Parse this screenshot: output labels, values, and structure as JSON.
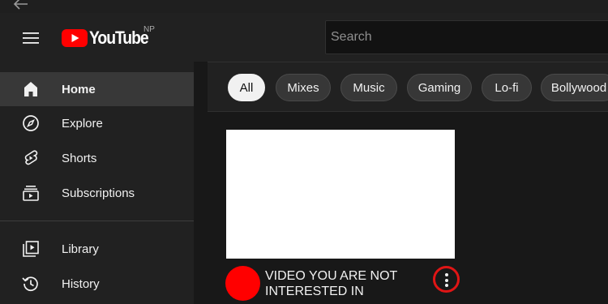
{
  "header": {
    "logo_text": "YouTube",
    "country_code": "NP",
    "search": {
      "placeholder": "Search",
      "value": ""
    }
  },
  "sidebar": {
    "items": [
      {
        "label": "Home",
        "icon": "home-icon",
        "active": true
      },
      {
        "label": "Explore",
        "icon": "compass-icon",
        "active": false
      },
      {
        "label": "Shorts",
        "icon": "shorts-icon",
        "active": false
      },
      {
        "label": "Subscriptions",
        "icon": "subscriptions-icon",
        "active": false
      },
      {
        "label": "Library",
        "icon": "library-icon",
        "active": false
      },
      {
        "label": "History",
        "icon": "history-icon",
        "active": false
      }
    ]
  },
  "chips": [
    {
      "label": "All",
      "active": true
    },
    {
      "label": "Mixes",
      "active": false
    },
    {
      "label": "Music",
      "active": false
    },
    {
      "label": "Gaming",
      "active": false
    },
    {
      "label": "Lo-fi",
      "active": false
    },
    {
      "label": "Bollywood",
      "active": false
    }
  ],
  "video": {
    "title_line1": "VIDEO YOU ARE NOT",
    "title_line2": "INTERESTED IN"
  },
  "colors": {
    "brand_red": "#ff0000",
    "highlight_ring": "#e01515",
    "sidebar_bg": "#212121",
    "active_item_bg": "#383838"
  }
}
